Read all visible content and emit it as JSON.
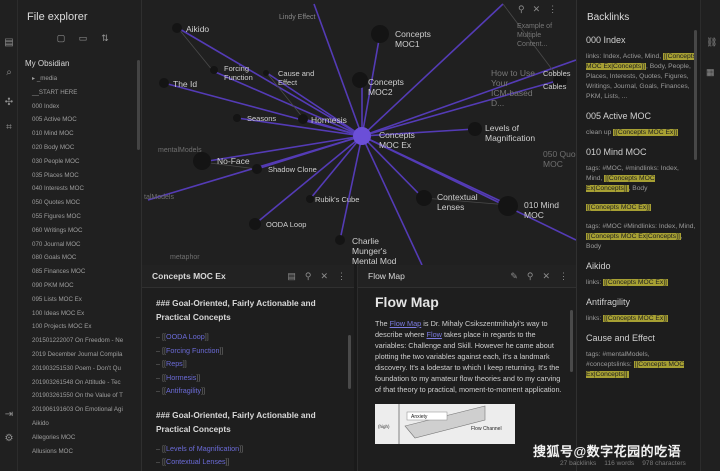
{
  "ribbon": {
    "icons": [
      "files-icon",
      "search-icon",
      "graph-icon",
      "tags-icon",
      "template-icon",
      "vault-icon",
      "settings-icon"
    ]
  },
  "explorer": {
    "title": "File explorer",
    "vault_name": "My Obsidian",
    "items": [
      "▸ _media",
      "__START HERE",
      "000 Index",
      "005 Active MOC",
      "010 Mind MOC",
      "020 Body MOC",
      "030 People MOC",
      "035 Places MOC",
      "040 Interests MOC",
      "050 Quotes MOC",
      "055 Figures MOC",
      "060 Writings MOC",
      "070 Journal MOC",
      "080 Goals MOC",
      "085 Finances MOC",
      "090 PKM MOC",
      "095 Lists MOC Ex",
      "100 Ideas MOC Ex",
      "100 Projects MOC Ex",
      "201501222007 On Freedom - Ne",
      "2019 December Journal Compila",
      "201903251530 Poem - Don't Qu",
      "201903261548 On Attitude - Tec",
      "201903261550 On the Value of T",
      "201906191603 On Emotional Agi",
      "Aikido",
      "Allegories MOC",
      "Allusions MOC"
    ]
  },
  "graph": {
    "center_label": "Concepts MOC Ex",
    "nodes": [
      "Lindy Effect",
      "Example of Multiple Content...",
      "Aikido",
      "Concepts MOC1",
      "Forcing Function",
      "Cause and Effect",
      "The Id",
      "Concepts MOC2",
      "How to Use Your ICM-based D...",
      "Cobbles",
      "Cables",
      "Seasons",
      "Hormesis",
      "Levels of Magnification",
      "050 Quo MOC",
      "mentalModels",
      "No-Face",
      "Shadow Clone",
      "Rubik's Cube",
      "Contextual Lenses",
      "010 Mind MOC",
      "talModels",
      "OODA Loop",
      "Charlie Munger's Mental Mod",
      "metaphor"
    ]
  },
  "concepts_pane": {
    "title": "Concepts MOC Ex",
    "heading1": "### Goal-Oriented, Fairly Actionable and Practical Concepts",
    "links1": [
      "OODA Loop",
      "Forcing Function",
      "Reps",
      "Hormesis",
      "Antifragility"
    ],
    "heading2": "### Goal-Oriented, Fairly Actionable and Practical Concepts",
    "links2": [
      "Levels of Magnification",
      "Contextual Lenses"
    ]
  },
  "flow_pane": {
    "tab_title": "Flow Map",
    "heading": "Flow Map",
    "p_before_link1": "The ",
    "link1": "Flow Map",
    "p_after_link1": " is Dr. Mihaly Csikszentmihalyi's way to describe where ",
    "link2": "Flow",
    "p_rest": " takes place in regards to the variables: Challenge and Skill. However he came about plotting the two variables against each, it's a landmark discovery. It's a lodestar to which I keep returning. It's the foundation to my amateur flow theories and to my carving of that theory to practical, moment-to-moment application.",
    "figure_labels": [
      "Anxiety",
      "Flow Channel",
      "(high)"
    ]
  },
  "backlinks": {
    "title": "Backlinks",
    "groups": [
      {
        "name": "000 Index",
        "text_before": "links: Index, Active, Mind, ",
        "hl1": "[[Concepts MOC Ex|Concepts]]",
        "text_after": ", Body, People, Places, Interests, Quotes, Figures, Writings, Journal, Goals, Finances, PKM, Lists, ..."
      },
      {
        "name": "005 Active MOC",
        "text_before": "clean up ",
        "hl1": "[[Concepts MOC Ex]]",
        "text_after": ""
      },
      {
        "name": "010 Mind MOC",
        "text_before": "tags: #MOC, #mindlinks: Index, Mind, ",
        "hl1": "[[Concepts MOC Ex|Concepts]]",
        "text_after": ", Body"
      },
      {
        "name": "",
        "text_before": "",
        "hl1": "[[Concepts MOC Ex]]",
        "text_after": ""
      },
      {
        "name": "",
        "text_before": "tags: #MOC #Mindlinks: Index, Mind, ",
        "hl1": "[[Concepts MOC Ex|Concepts]]",
        "text_after": ", Body"
      },
      {
        "name": "Aikido",
        "text_before": "links: ",
        "hl1": "[[Concepts MOC Ex]]",
        "text_after": ""
      },
      {
        "name": "Antifragility",
        "text_before": "links: ",
        "hl1": "[[Concepts MOC Ex]]",
        "text_after": ""
      },
      {
        "name": "Cause and Effect",
        "text_before": "tags: #mentalModels, #conceptslinks: ",
        "hl1": "[[Concepts MOC Ex|Concepts]]",
        "text_after": ""
      }
    ]
  },
  "status": {
    "backlinks": "27 backlinks",
    "words": "116 words",
    "chars": "978 characters"
  },
  "watermark": "搜狐号@数字花园的吃语",
  "colors": {
    "accent": "#6b4fd8",
    "highlight": "#a7a033",
    "background": "#1e1e1e"
  }
}
